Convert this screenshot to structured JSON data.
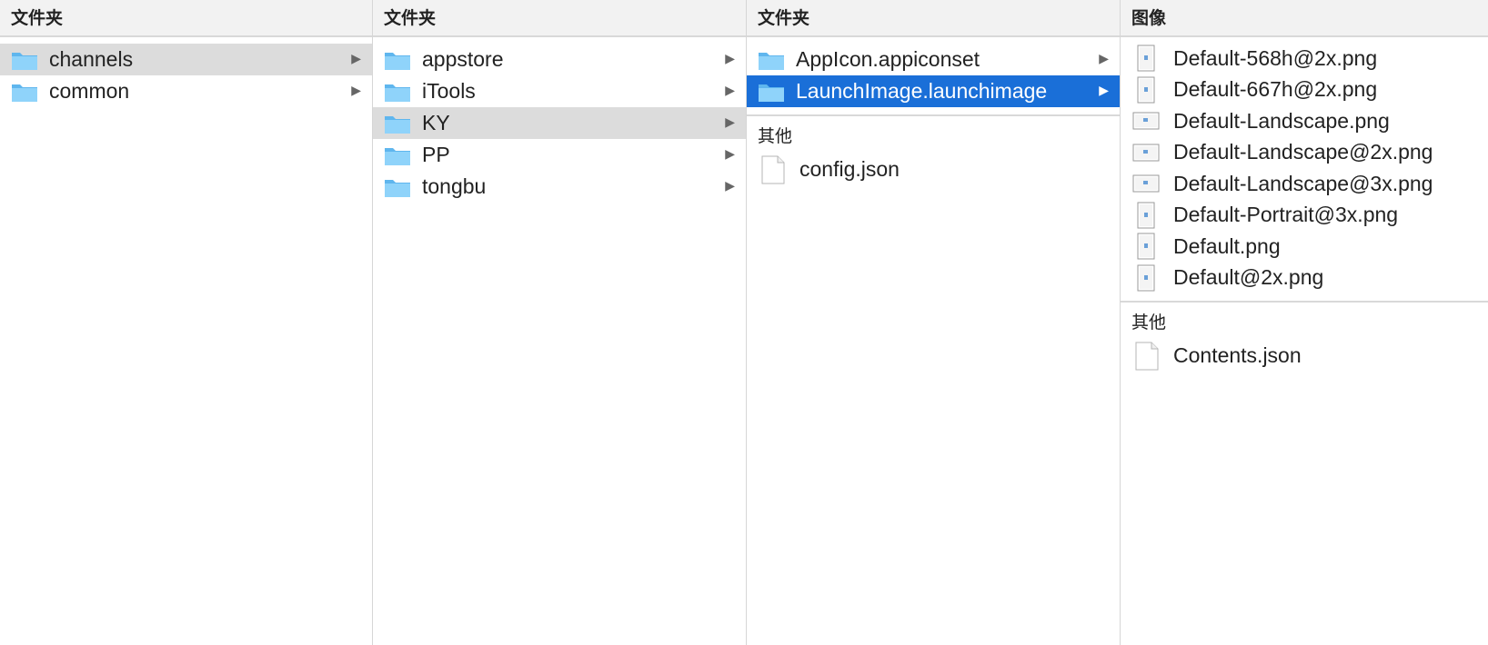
{
  "columns": [
    {
      "header": "文件夹",
      "items": [
        {
          "label": "channels",
          "selected": "gray"
        },
        {
          "label": "common",
          "selected": ""
        }
      ]
    },
    {
      "header": "文件夹",
      "items": [
        {
          "label": "appstore",
          "selected": ""
        },
        {
          "label": "iTools",
          "selected": ""
        },
        {
          "label": "KY",
          "selected": "gray"
        },
        {
          "label": "PP",
          "selected": ""
        },
        {
          "label": "tongbu",
          "selected": ""
        }
      ]
    },
    {
      "header": "文件夹",
      "items": [
        {
          "label": "AppIcon.appiconset",
          "selected": ""
        },
        {
          "label": "LaunchImage.launchimage",
          "selected": "blue"
        }
      ],
      "other_header": "其他",
      "other_items": [
        {
          "label": "config.json"
        }
      ]
    },
    {
      "header": "图像",
      "items": [
        {
          "label": "Default-568h@2x.png",
          "orientation": "portrait"
        },
        {
          "label": "Default-667h@2x.png",
          "orientation": "portrait"
        },
        {
          "label": "Default-Landscape.png",
          "orientation": "landscape"
        },
        {
          "label": "Default-Landscape@2x.png",
          "orientation": "landscape"
        },
        {
          "label": "Default-Landscape@3x.png",
          "orientation": "landscape"
        },
        {
          "label": "Default-Portrait@3x.png",
          "orientation": "portrait"
        },
        {
          "label": "Default.png",
          "orientation": "portrait"
        },
        {
          "label": "Default@2x.png",
          "orientation": "portrait"
        }
      ],
      "other_header": "其他",
      "other_items": [
        {
          "label": "Contents.json"
        }
      ]
    }
  ],
  "colors": {
    "selection_blue": "#1a6fd8",
    "selection_gray": "#dcdcdc",
    "folder_blue": "#6ec3f4"
  },
  "icons": {
    "folder": "folder-icon",
    "file": "document-icon",
    "image": "image-file-icon",
    "disclosure": "disclosure-arrow-icon"
  }
}
